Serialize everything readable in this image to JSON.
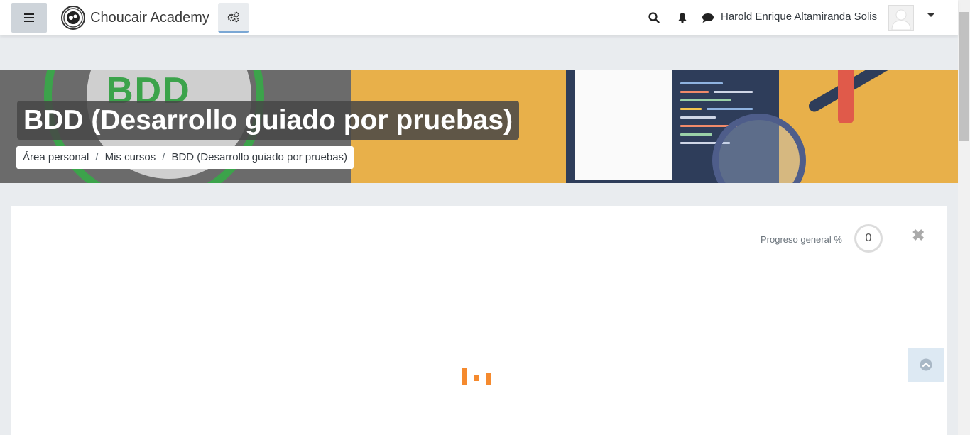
{
  "navbar": {
    "brand_name": "Choucair Academy",
    "user_name": "Harold Enrique Altamiranda Solis",
    "icons": [
      "hamburger-icon",
      "gears-icon",
      "search-icon",
      "bell-icon",
      "chat-icon",
      "caret-down-icon"
    ]
  },
  "banner": {
    "image_text": "BDD"
  },
  "course": {
    "title": "BDD (Desarrollo guiado por pruebas)",
    "breadcrumb": [
      "Área personal",
      "Mis cursos",
      "BDD (Desarrollo guiado por pruebas)"
    ],
    "breadcrumb_separator": "/"
  },
  "progress": {
    "label": "Progreso general %",
    "value": "0",
    "close_symbol": "✖"
  },
  "colors": {
    "accent_orange": "#f58a2e",
    "banner_yellow": "#e8b04a",
    "bdd_green": "#3ca34b"
  }
}
